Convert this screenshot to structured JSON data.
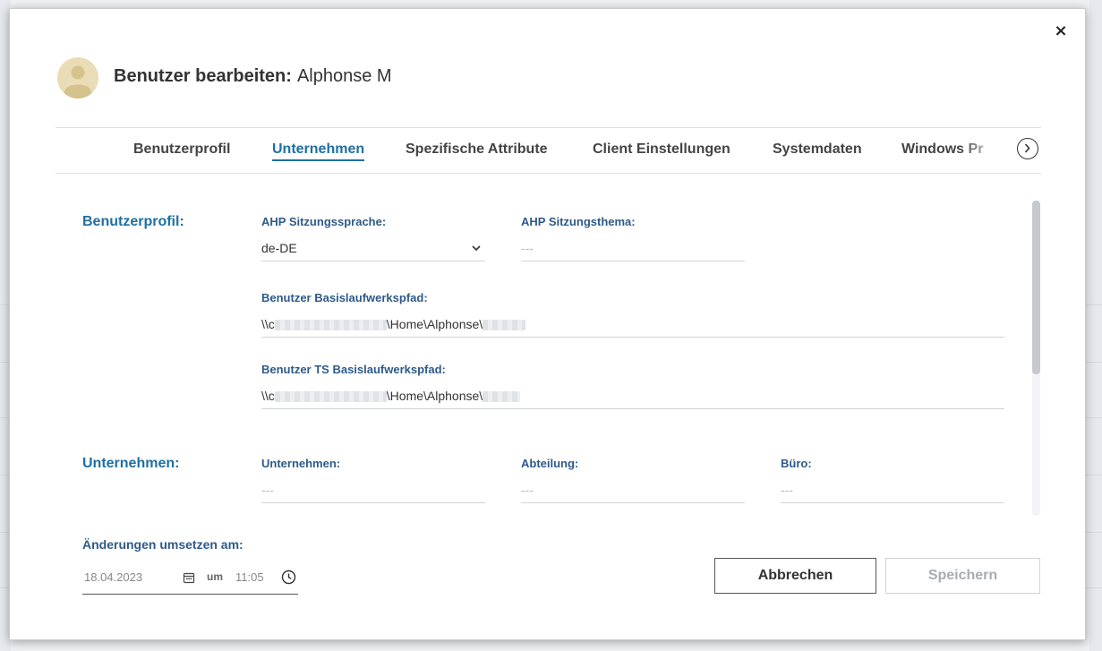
{
  "dialog": {
    "title_prefix": "Benutzer bearbeiten:",
    "user_name": "Alphonse M",
    "close_symbol": "×"
  },
  "tabs": [
    {
      "label": "Benutzerprofil"
    },
    {
      "label": "Unternehmen"
    },
    {
      "label": "Spezifische Attribute"
    },
    {
      "label": "Client Einstellungen"
    },
    {
      "label": "Systemdaten"
    },
    {
      "label": "Windows Pr"
    }
  ],
  "active_tab": "Unternehmen",
  "sections": {
    "profile": {
      "label": "Benutzerprofil:",
      "language_label": "AHP Sitzungssprache:",
      "language_value": "de-DE",
      "theme_label": "AHP Sitzungsthema:",
      "theme_value": "---",
      "base_path_label": "Benutzer Basislaufwerkspfad:",
      "base_path_prefix": "\\\\c",
      "base_path_middle": "\\Home\\Alphonse\\",
      "ts_path_label": "Benutzer TS Basislaufwerkspfad:",
      "ts_path_prefix": "\\\\c",
      "ts_path_middle": "\\Home\\Alphonse\\"
    },
    "company": {
      "label": "Unternehmen:",
      "company_label": "Unternehmen:",
      "company_value": "---",
      "department_label": "Abteilung:",
      "department_value": "---",
      "office_label": "Büro:",
      "office_value": "---"
    }
  },
  "footer": {
    "apply_label": "Änderungen umsetzen am:",
    "date": "18.04.2023",
    "at_word": "um",
    "time": "11:05",
    "cancel_label": "Abbrechen",
    "save_label": "Speichern"
  },
  "colors": {
    "accent": "#1f6fa3",
    "label": "#2e5a8a",
    "disabled": "#a9adb2"
  },
  "icons": {
    "close": "close-icon",
    "avatar": "user-avatar-icon",
    "next": "chevron-right-icon",
    "dropdown": "chevron-down-icon",
    "calendar": "calendar-icon",
    "clock": "clock-icon"
  }
}
